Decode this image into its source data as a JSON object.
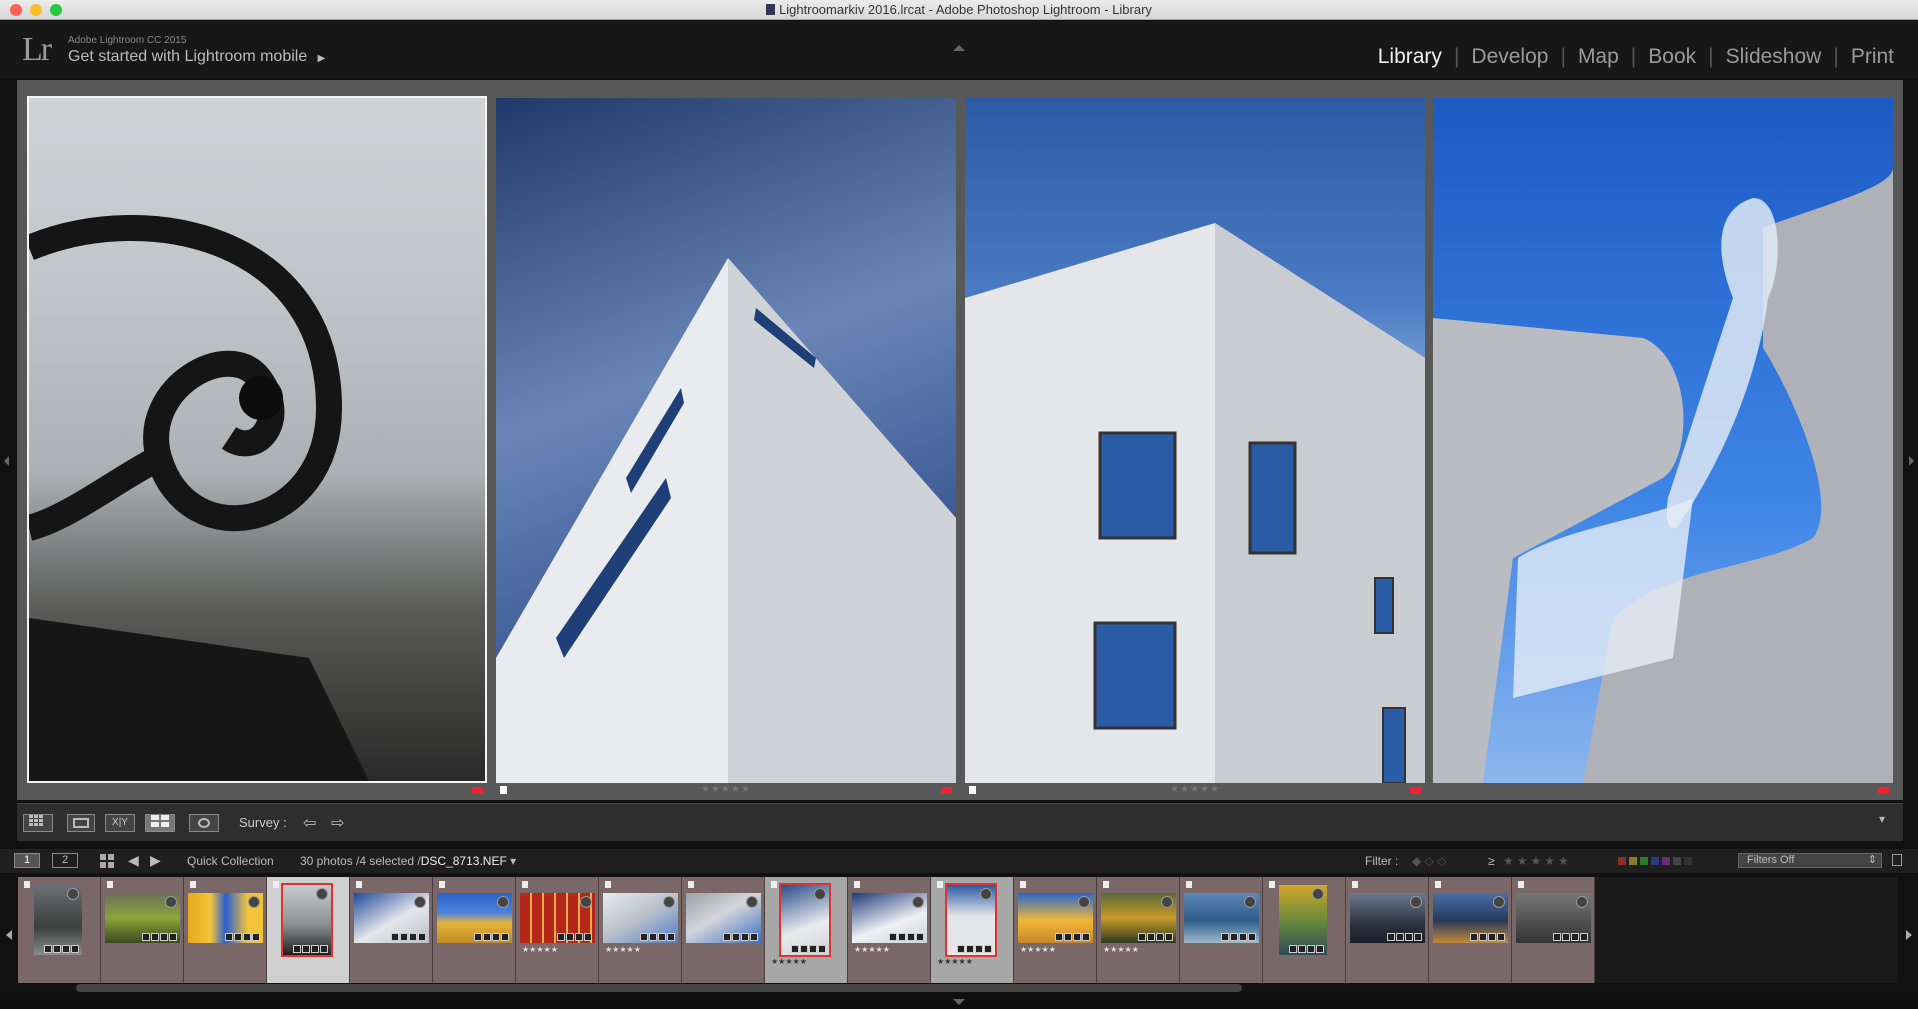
{
  "window": {
    "title": "Lightroomarkiv 2016.lrcat - Adobe Photoshop Lightroom - Library",
    "colors": {
      "close": "#ff5f57",
      "minimize": "#febc2e",
      "zoom": "#28c840"
    }
  },
  "header": {
    "logo": "Lr",
    "version": "Adobe Lightroom CC 2015",
    "mobile": "Get started with Lightroom mobile",
    "play_icon": "▶",
    "modules": [
      "Library",
      "Develop",
      "Map",
      "Book",
      "Slideshow",
      "Print"
    ],
    "active_module": "Library"
  },
  "survey": {
    "photos": [
      {
        "name": "iron-scroll-railing",
        "selected": true,
        "color_label": "#e23344",
        "stars": ""
      },
      {
        "name": "white-building-corner-clouds",
        "selected": false,
        "color_label": "#e23344",
        "stars": "★★★★★"
      },
      {
        "name": "white-building-blue-windows",
        "selected": false,
        "color_label": "#e23344",
        "stars": "★★★★★"
      },
      {
        "name": "ice-sculpture-stone-chair",
        "selected": false,
        "color_label": "#e23344",
        "stars": ""
      }
    ]
  },
  "toolbar": {
    "grid_icon": "grid-view-icon",
    "loupe_icon": "loupe-view-icon",
    "compare_label": "X|Y",
    "survey_icon": "survey-view-icon",
    "people_icon": "people-view-icon",
    "survey_label": "Survey :",
    "prev_arrow": "⇦",
    "next_arrow": "⇨",
    "dropdown": "▾"
  },
  "filmbar": {
    "page1": "1",
    "page2": "2",
    "source": "Quick Collection",
    "count": "30 photos /4 selected /",
    "filename": "DSC_8713.NEF",
    "dropdown": "▾",
    "filter_label": "Filter :",
    "rating_op": "≥",
    "stars": "★★★★★",
    "filters_value": "Filters Off"
  },
  "filmstrip": {
    "thumbs": [
      {
        "kind": "waterfall",
        "state": "normal",
        "stars": ""
      },
      {
        "kind": "moss",
        "state": "normal",
        "stars": ""
      },
      {
        "kind": "yellow-blue",
        "state": "normal",
        "stars": ""
      },
      {
        "kind": "scroll",
        "state": "active",
        "stars": ""
      },
      {
        "kind": "building-1",
        "state": "normal",
        "stars": ""
      },
      {
        "kind": "yellow-house",
        "state": "normal",
        "stars": ""
      },
      {
        "kind": "red-facade",
        "state": "normal",
        "stars": "★★★★★"
      },
      {
        "kind": "building-2",
        "state": "normal",
        "stars": "★★★★★"
      },
      {
        "kind": "concrete",
        "state": "normal",
        "stars": ""
      },
      {
        "kind": "building-3",
        "state": "selected",
        "stars": "★★★★★"
      },
      {
        "kind": "building-4",
        "state": "normal",
        "stars": "★★★★★"
      },
      {
        "kind": "building-5",
        "state": "selected",
        "stars": "★★★★★"
      },
      {
        "kind": "yellow-house-2",
        "state": "normal",
        "stars": "★★★★★"
      },
      {
        "kind": "autumn",
        "state": "normal",
        "stars": "★★★★★"
      },
      {
        "kind": "lake",
        "state": "normal",
        "stars": ""
      },
      {
        "kind": "autumn-lake",
        "state": "normal",
        "stars": ""
      },
      {
        "kind": "mountains",
        "state": "normal",
        "stars": ""
      },
      {
        "kind": "mountains-2",
        "state": "normal",
        "stars": ""
      },
      {
        "kind": "partial",
        "state": "normal",
        "stars": ""
      }
    ]
  }
}
